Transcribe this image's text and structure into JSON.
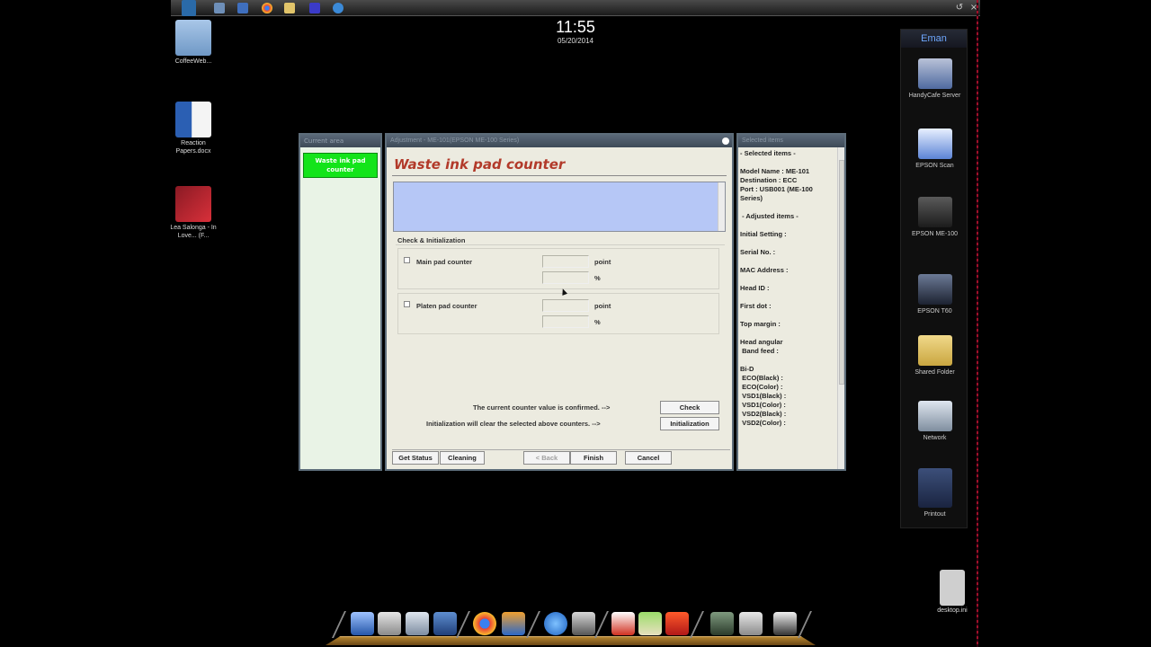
{
  "clock": {
    "time": "11:55",
    "date": "05/20/2014"
  },
  "desktop_icons": [
    {
      "label": "CoffeeWeb..."
    },
    {
      "label": "Reaction Papers.docx"
    },
    {
      "label": "Lea Salonga - In Love... (F..."
    }
  ],
  "side_panel": {
    "title": "Eman",
    "items": [
      {
        "label": "HandyCafe Server"
      },
      {
        "label": "EPSON Scan"
      },
      {
        "label": "EPSON ME-100"
      },
      {
        "label": "EPSON T60"
      },
      {
        "label": "Shared Folder"
      },
      {
        "label": "Network"
      },
      {
        "label": "Printout"
      }
    ]
  },
  "desktop_file": {
    "label": "desktop.ini"
  },
  "left_panel": {
    "title": "Current area",
    "selected_item": "Waste ink pad counter"
  },
  "dialog": {
    "title": "Adjustment - ME-101(EPSON ME-100 Series)",
    "heading": "Waste ink pad counter",
    "group_label": "Check & Initialization",
    "main_pad": {
      "label": "Main pad counter",
      "unit_point": "point",
      "unit_percent": "%"
    },
    "platen_pad": {
      "label": "Platen pad counter",
      "unit_point": "point",
      "unit_percent": "%"
    },
    "confirm_text": "The current counter value is confirmed. -->",
    "init_text": "Initialization will clear the selected above counters. -->",
    "check_button": "Check",
    "init_button": "Initialization",
    "get_status_button": "Get Status",
    "cleaning_button": "Cleaning",
    "back_button": "< Back",
    "finish_button": "Finish",
    "cancel_button": "Cancel"
  },
  "right_panel": {
    "title": "Selected items",
    "lines": [
      "- Selected items -",
      "",
      "Model Name : ME-101",
      "Destination : ECC",
      "Port : USB001 (ME-100",
      "Series)",
      "",
      " - Adjusted items -",
      "",
      "Initial Setting :",
      "",
      "Serial No. :",
      "",
      "MAC Address :",
      "",
      "Head ID :",
      "",
      "First dot :",
      "",
      "Top margin :",
      "",
      "Head angular",
      " Band feed :",
      "",
      "Bi-D",
      " ECO(Black) :",
      " ECO(Color) :",
      " VSD1(Black) :",
      " VSD1(Color) :",
      " VSD2(Black) :",
      " VSD2(Color) :"
    ]
  },
  "colors": {
    "selected_green": "#13e41a",
    "heading_red": "#b23a2a",
    "message_blue": "#b6c7f6",
    "side_title_blue": "#6fa8ff"
  }
}
